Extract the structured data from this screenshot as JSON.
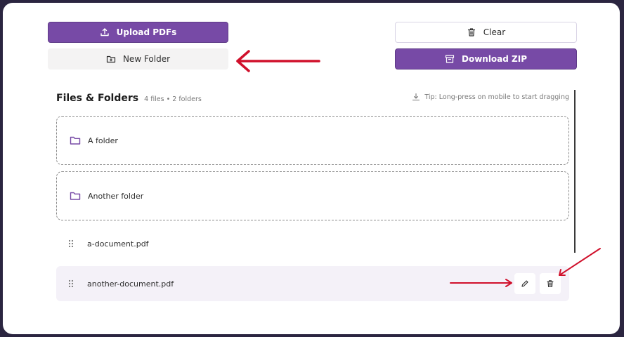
{
  "toolbar": {
    "upload_label": "Upload PDFs",
    "new_folder_label": "New Folder",
    "clear_label": "Clear",
    "download_label": "Download ZIP"
  },
  "files_section": {
    "title": "Files & Folders",
    "count": "4 files • 2 folders",
    "tip": "Tip: Long-press on mobile to start dragging"
  },
  "folders": [
    {
      "name": "A folder"
    },
    {
      "name": "Another folder"
    }
  ],
  "files": [
    {
      "name": "a-document.pdf"
    },
    {
      "name": "another-document.pdf"
    }
  ],
  "icons": {
    "upload": "upload-icon",
    "new_folder": "folder-plus-icon",
    "clear": "trash-icon",
    "download": "archive-icon",
    "tip": "download-arrow-icon",
    "folder": "folder-icon",
    "drag": "drag-handle-icon",
    "rename": "pencil-icon",
    "delete": "trash-icon"
  },
  "colors": {
    "accent": "#774aa6",
    "annotation_arrow": "#d0102b",
    "frame_background": "#2b2540"
  }
}
